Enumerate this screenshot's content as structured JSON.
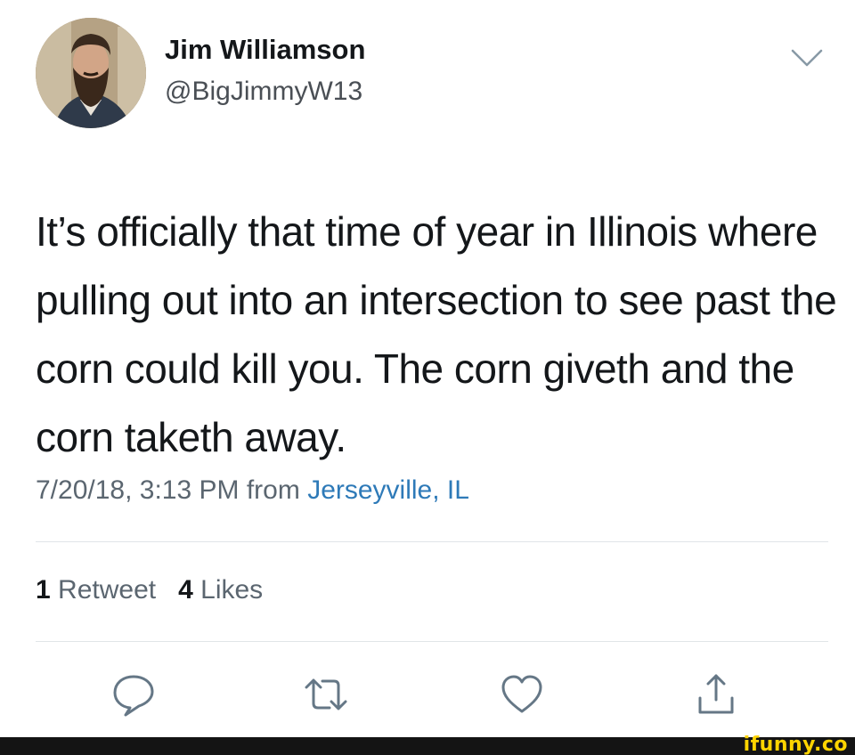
{
  "user": {
    "display_name": "Jim Williamson",
    "handle": "@BigJimmyW13"
  },
  "tweet": {
    "text": "It’s officially that time of year in Illinois where pulling out into an intersection to see past the corn could kill you.  The corn giveth and the corn taketh away.",
    "timestamp": "7/20/18, 3:13 PM",
    "from_label": "from",
    "location": "Jerseyville, IL"
  },
  "stats": {
    "retweet_count": "1",
    "retweet_label": "Retweet",
    "like_count": "4",
    "like_label": "Likes"
  },
  "actions": [
    {
      "name": "reply",
      "icon": "reply-icon"
    },
    {
      "name": "retweet",
      "icon": "retweet-icon"
    },
    {
      "name": "like",
      "icon": "heart-icon"
    },
    {
      "name": "share",
      "icon": "share-icon"
    }
  ],
  "watermark": "ifunny.co",
  "colors": {
    "text": "#14171a",
    "secondary": "#5b6670",
    "link": "#2e7ab8",
    "icon": "#657786",
    "divider": "#e1e5e8",
    "watermark": "#ffd400"
  }
}
